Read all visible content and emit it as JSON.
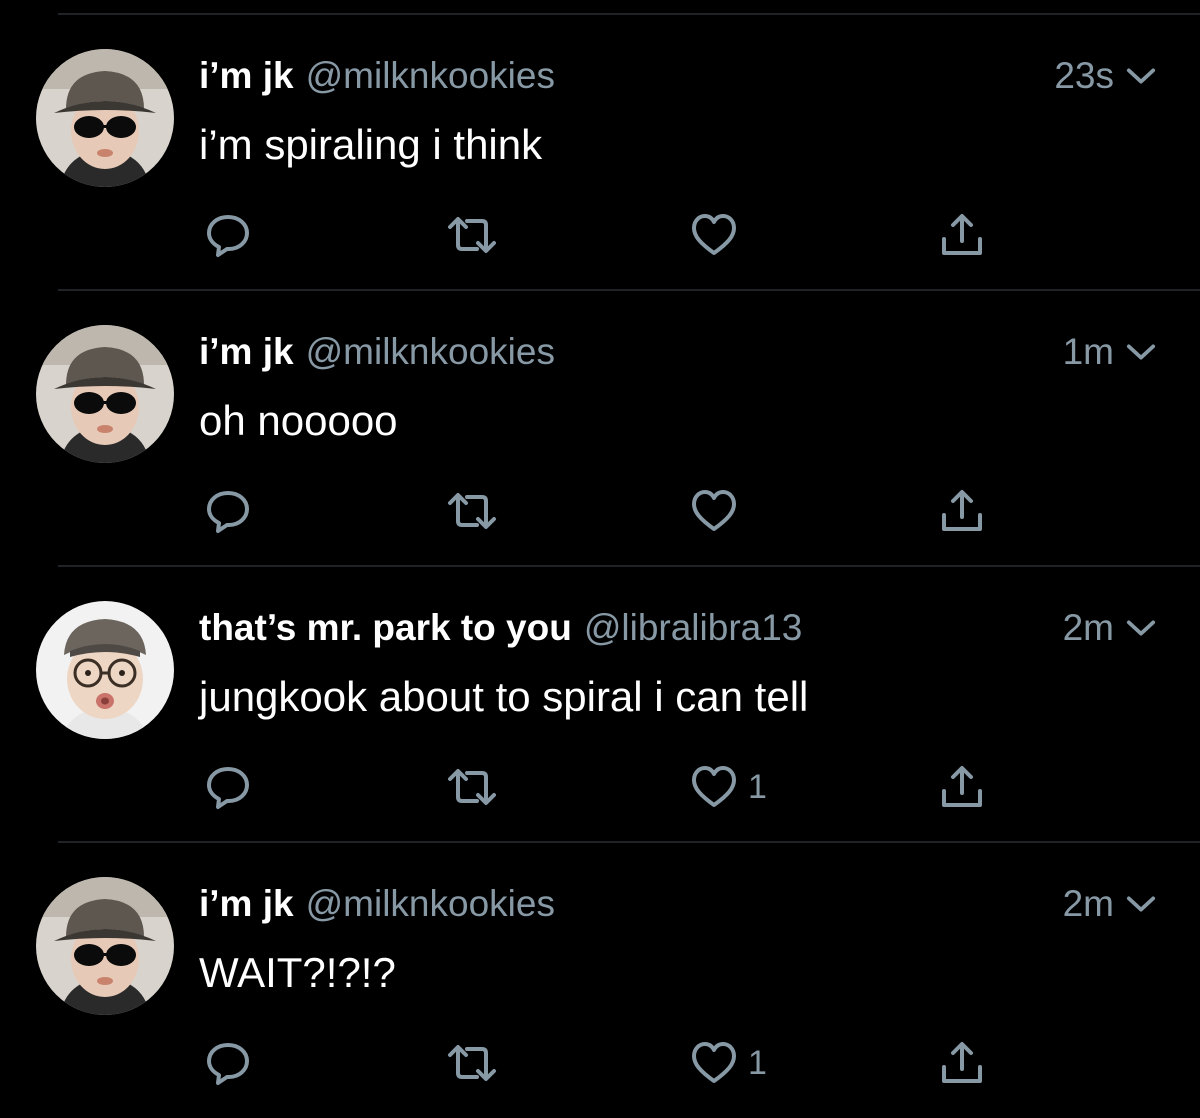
{
  "tweets": [
    {
      "display_name": "i’m jk",
      "handle": "@milknkookies",
      "time": "23s",
      "text": "i’m spiraling i think",
      "like_count": "",
      "avatar": "jk-avatar"
    },
    {
      "display_name": "i’m jk",
      "handle": "@milknkookies",
      "time": "1m",
      "text": "oh nooooo",
      "like_count": "",
      "avatar": "jk-avatar"
    },
    {
      "display_name": "that’s mr. park to you",
      "handle": "@libralibra13",
      "time": "2m",
      "text": "jungkook about to spiral i can tell",
      "like_count": "1",
      "avatar": "park-avatar"
    },
    {
      "display_name": "i’m jk",
      "handle": "@milknkookies",
      "time": "2m",
      "text": "WAIT?!?!?",
      "like_count": "1",
      "avatar": "jk-avatar"
    }
  ],
  "icons": {
    "reply": "reply-icon",
    "retweet": "retweet-icon",
    "like": "heart-icon",
    "share": "share-icon",
    "menu": "chevron-down-icon"
  },
  "colors": {
    "background": "#000000",
    "primary_text": "#ffffff",
    "secondary_text": "#8899a6",
    "divider": "#1e2328"
  }
}
